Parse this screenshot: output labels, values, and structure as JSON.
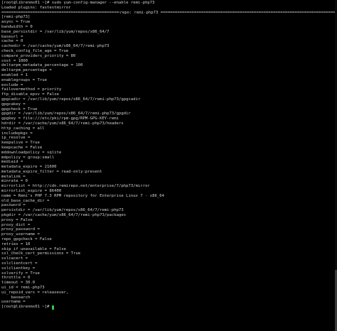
{
  "terminal": {
    "command_line": "[root@librenms01 ~]# sudo yum-config-manager --enable remi-php73",
    "loaded_plugins": "Loaded plugins: fastestmirror",
    "repo_header": {
      "left": "=================================================================== ",
      "center": "repo: remi-php73",
      "right": " ====================================================================================================="
    },
    "lines": [
      "[remi-php73]",
      "async = True",
      "bandwidth = 0",
      "base_persistdir = /var/lib/yum/repos/x86_64/7",
      "baseurl =",
      "cache = 0",
      "cachedir = /var/cache/yum/x86_64/7/remi-php73",
      "check_config_file_age = True",
      "compare_providers_priority = 80",
      "cost = 1000",
      "deltarpm_metadata_percentage = 100",
      "deltarpm_percentage =",
      "enabled = 1",
      "enablegroups = True",
      "exclude =",
      "failovermethod = priority",
      "ftp_disable_epsv = False",
      "gpgcadir = /var/lib/yum/repos/x86_64/7/remi-php73/gpgcadir",
      "gpgcakey =",
      "gpgcheck = True",
      "gpgdir = /var/lib/yum/repos/x86_64/7/remi-php73/gpgdir",
      "gpgkey = file:///etc/pki/rpm-gpg/RPM-GPG-KEY-remi",
      "hdrdir = /var/cache/yum/x86_64/7/remi-php73/headers",
      "http_caching = all",
      "includepkgs =",
      "ip_resolve =",
      "keepalive = True",
      "keepcache = False",
      "mddownloadpolicy = sqlite",
      "mdpolicy = group:small",
      "mediaid =",
      "metadata_expire = 21600",
      "metadata_expire_filter = read-only:present",
      "metalink =",
      "minrate = 0",
      "mirrorlist = http://cdn.remirepo.net/enterprise/7/php73/mirror",
      "mirrorlist_expire = 86400",
      "name = Remi's PHP 7.3 RPM repository for Enterprise Linux 7 - x86_64",
      "old_base_cache_dir =",
      "password =",
      "persistdir = /var/lib/yum/repos/x86_64/7/remi-php73",
      "pkgdir = /var/cache/yum/x86_64/7/remi-php73/packages",
      "proxy = False",
      "proxy_dict =",
      "proxy_password =",
      "proxy_username =",
      "repo_gpgcheck = False",
      "retries = 10",
      "skip_if_unavailable = False",
      "ssl_check_cert_permissions = True",
      "sslcacert =",
      "sslclientcert =",
      "sslclientkey =",
      "sslverify = True",
      "throttle = 0",
      "timeout = 30.0",
      "ui_id = remi-php73",
      "ui_repoid_vars = releasever,",
      "    basearch",
      "username ="
    ],
    "prompt": "[root@librenms01 ~]# "
  },
  "colors": {
    "background": "#000000",
    "foreground": "#cfcfcf",
    "cursor": "#2ecc40"
  },
  "icons": {
    "cursor": "block-cursor"
  }
}
